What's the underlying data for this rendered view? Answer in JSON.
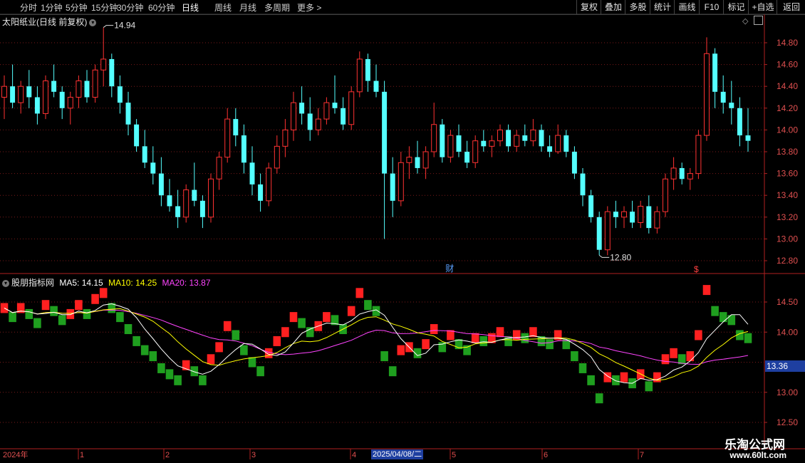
{
  "toolbar": {
    "periods": [
      "分时",
      "1分钟",
      "5分钟",
      "15分钟",
      "30分钟",
      "60分钟",
      "日线",
      "周线",
      "月线",
      "多周期",
      "更多"
    ],
    "more_suffix": ">",
    "active_index": 6,
    "right_buttons": [
      "复权",
      "叠加",
      "多股",
      "统计",
      "画线",
      "F10",
      "标记",
      "+自选",
      "返回"
    ]
  },
  "main_panel": {
    "title": "太阳纸业(日线 前复权)",
    "high_marker": "14.94",
    "low_marker": "12.80",
    "finance_marker": "财",
    "dollar_marker": "$",
    "y_ticks": [
      "14.80",
      "14.60",
      "14.40",
      "14.20",
      "14.00",
      "13.80",
      "13.60",
      "13.40",
      "13.20",
      "13.00",
      "12.80"
    ]
  },
  "sub_panel": {
    "name": "股朋指标网",
    "ma5_label": "MA5: 14.15",
    "ma10_label": "MA10: 14.25",
    "ma20_label": "MA20: 13.87",
    "y_ticks": [
      "14.50",
      "14.00",
      "13.00",
      "12.50"
    ],
    "current_value": "13.36"
  },
  "x_axis": {
    "year_label": "2024年",
    "months": [
      "1",
      "2",
      "3",
      "4",
      "5",
      "6",
      "7"
    ],
    "selected_date": "2025/04/08/二"
  },
  "watermark": {
    "name": "乐淘公式网",
    "url": "www.60lt.com"
  },
  "colors": {
    "up": "#ff3232",
    "down": "#54ffff",
    "sub_up": "#ff2020",
    "sub_down": "#1f9f1f",
    "ma5": "#ffffff",
    "ma10": "#ffff00",
    "ma20": "#ff44ff",
    "grid": "#7a1a1a",
    "axis_text": "#e05050"
  },
  "chart_data": {
    "type": "candlestick",
    "series": [
      {
        "ohlc": [
          [
            14.3,
            14.5,
            14.1,
            14.4
          ],
          [
            14.4,
            14.6,
            14.2,
            14.25
          ],
          [
            14.25,
            14.45,
            14.15,
            14.4
          ],
          [
            14.4,
            14.55,
            14.2,
            14.3
          ],
          [
            14.3,
            14.4,
            14.05,
            14.15
          ],
          [
            14.15,
            14.5,
            14.1,
            14.45
          ],
          [
            14.45,
            14.6,
            14.3,
            14.35
          ],
          [
            14.35,
            14.4,
            14.1,
            14.2
          ],
          [
            14.2,
            14.35,
            14.05,
            14.3
          ],
          [
            14.3,
            14.5,
            14.2,
            14.45
          ],
          [
            14.45,
            14.55,
            14.25,
            14.3
          ],
          [
            14.3,
            14.6,
            14.25,
            14.55
          ],
          [
            14.55,
            14.94,
            14.4,
            14.65
          ],
          [
            14.65,
            14.7,
            14.3,
            14.4
          ],
          [
            14.4,
            14.5,
            14.15,
            14.25
          ],
          [
            14.25,
            14.35,
            13.95,
            14.05
          ],
          [
            14.05,
            14.1,
            13.8,
            13.85
          ],
          [
            13.85,
            14.0,
            13.65,
            13.7
          ],
          [
            13.7,
            13.85,
            13.5,
            13.6
          ],
          [
            13.6,
            13.75,
            13.3,
            13.4
          ],
          [
            13.4,
            13.55,
            13.25,
            13.3
          ],
          [
            13.3,
            13.45,
            13.1,
            13.2
          ],
          [
            13.2,
            13.5,
            13.15,
            13.45
          ],
          [
            13.45,
            13.7,
            13.3,
            13.35
          ],
          [
            13.35,
            13.4,
            13.1,
            13.2
          ],
          [
            13.2,
            13.6,
            13.15,
            13.55
          ],
          [
            13.55,
            13.8,
            13.45,
            13.75
          ],
          [
            13.75,
            14.2,
            13.7,
            14.1
          ],
          [
            14.1,
            14.2,
            13.85,
            13.95
          ],
          [
            13.95,
            14.05,
            13.6,
            13.7
          ],
          [
            13.7,
            13.85,
            13.4,
            13.5
          ],
          [
            13.5,
            13.6,
            13.25,
            13.35
          ],
          [
            13.35,
            13.7,
            13.3,
            13.65
          ],
          [
            13.65,
            13.95,
            13.6,
            13.85
          ],
          [
            13.85,
            14.1,
            13.75,
            14.0
          ],
          [
            14.0,
            14.35,
            13.9,
            14.25
          ],
          [
            14.25,
            14.4,
            14.05,
            14.15
          ],
          [
            14.15,
            14.3,
            13.9,
            14.0
          ],
          [
            14.0,
            14.2,
            13.95,
            14.1
          ],
          [
            14.1,
            14.3,
            14.05,
            14.25
          ],
          [
            14.25,
            14.5,
            14.15,
            14.2
          ],
          [
            14.2,
            14.3,
            14.0,
            14.05
          ],
          [
            14.05,
            14.4,
            14.0,
            14.35
          ],
          [
            14.35,
            14.72,
            14.3,
            14.65
          ],
          [
            14.65,
            14.7,
            14.35,
            14.45
          ],
          [
            14.45,
            14.6,
            14.3,
            14.35
          ],
          [
            14.35,
            14.45,
            13.0,
            13.6
          ],
          [
            13.6,
            13.75,
            13.2,
            13.35
          ],
          [
            13.35,
            13.8,
            13.3,
            13.7
          ],
          [
            13.7,
            13.85,
            13.55,
            13.75
          ],
          [
            13.75,
            13.9,
            13.6,
            13.65
          ],
          [
            13.65,
            13.85,
            13.55,
            13.8
          ],
          [
            13.8,
            14.25,
            13.75,
            14.05
          ],
          [
            14.05,
            14.1,
            13.7,
            13.75
          ],
          [
            13.75,
            14.0,
            13.7,
            13.95
          ],
          [
            13.95,
            14.05,
            13.75,
            13.8
          ],
          [
            13.8,
            13.9,
            13.65,
            13.7
          ],
          [
            13.7,
            13.95,
            13.65,
            13.9
          ],
          [
            13.9,
            14.0,
            13.8,
            13.85
          ],
          [
            13.85,
            13.95,
            13.75,
            13.9
          ],
          [
            13.9,
            14.05,
            13.85,
            14.0
          ],
          [
            14.0,
            14.05,
            13.8,
            13.85
          ],
          [
            13.85,
            14.0,
            13.8,
            13.95
          ],
          [
            13.95,
            14.05,
            13.85,
            13.9
          ],
          [
            13.9,
            14.1,
            13.85,
            14.0
          ],
          [
            14.0,
            14.05,
            13.8,
            13.85
          ],
          [
            13.85,
            13.95,
            13.75,
            13.8
          ],
          [
            13.8,
            14.05,
            13.78,
            13.95
          ],
          [
            13.95,
            14.0,
            13.75,
            13.8
          ],
          [
            13.8,
            13.85,
            13.55,
            13.6
          ],
          [
            13.6,
            13.65,
            13.3,
            13.4
          ],
          [
            13.4,
            13.45,
            13.15,
            13.2
          ],
          [
            13.2,
            13.25,
            12.85,
            12.9
          ],
          [
            12.9,
            13.3,
            12.85,
            13.25
          ],
          [
            13.25,
            13.35,
            13.1,
            13.2
          ],
          [
            13.2,
            13.3,
            13.1,
            13.25
          ],
          [
            13.25,
            13.35,
            13.1,
            13.15
          ],
          [
            13.15,
            13.35,
            13.1,
            13.3
          ],
          [
            13.3,
            13.4,
            13.05,
            13.1
          ],
          [
            13.1,
            13.3,
            13.05,
            13.25
          ],
          [
            13.25,
            13.6,
            13.2,
            13.55
          ],
          [
            13.55,
            13.75,
            13.45,
            13.65
          ],
          [
            13.65,
            13.7,
            13.5,
            13.55
          ],
          [
            13.55,
            13.65,
            13.45,
            13.6
          ],
          [
            13.6,
            14.0,
            13.55,
            13.95
          ],
          [
            13.95,
            14.85,
            13.9,
            14.7
          ],
          [
            14.7,
            14.75,
            14.2,
            14.35
          ],
          [
            14.35,
            14.5,
            14.15,
            14.25
          ],
          [
            14.25,
            14.45,
            14.05,
            14.2
          ],
          [
            14.2,
            14.3,
            13.85,
            13.95
          ],
          [
            13.95,
            14.2,
            13.8,
            13.9
          ]
        ]
      }
    ],
    "ylim": [
      12.7,
      14.95
    ],
    "sub_ylim": [
      12.5,
      14.9
    ],
    "grid": true
  }
}
